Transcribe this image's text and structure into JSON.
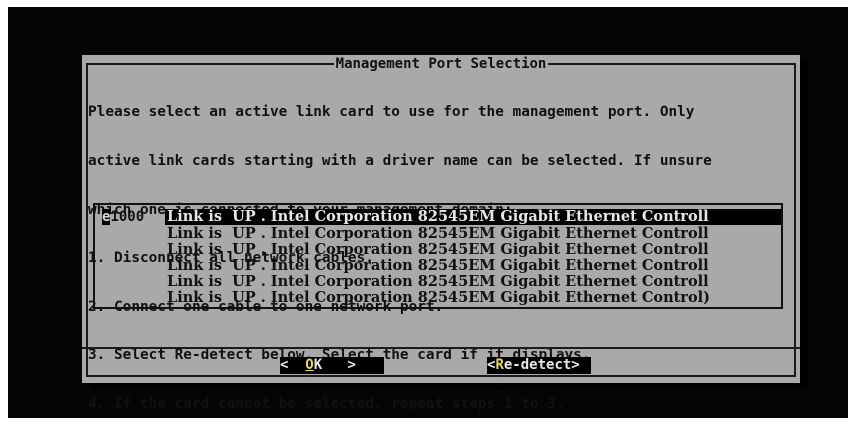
{
  "dialog": {
    "title": "Management Port Selection",
    "instructions": [
      "Please select an active link card to use for the management port. Only",
      "active link cards starting with a driver name can be selected. If unsure",
      "which one is connected to your management domain:",
      "1. Disconnect all network cables.",
      "2. Connect one cable to one network port.",
      "3. Select Re-detect below. Select the card if it displays.",
      "4. If the card cannot be selected, repeat steps 1 to 3."
    ],
    "cards": [
      {
        "driver_first": "e",
        "driver_rest": "1000",
        "desc": "Link is  UP . Intel Corporation 82545EM Gigabit Ethernet Controll"
      },
      {
        "driver_first": "",
        "driver_rest": "",
        "desc": "Link is  UP . Intel Corporation 82545EM Gigabit Ethernet Controll"
      },
      {
        "driver_first": "",
        "driver_rest": "",
        "desc": "Link is  UP . Intel Corporation 82545EM Gigabit Ethernet Controll"
      },
      {
        "driver_first": "",
        "driver_rest": "",
        "desc": "Link is  UP . Intel Corporation 82545EM Gigabit Ethernet Controll"
      },
      {
        "driver_first": "",
        "driver_rest": "",
        "desc": "Link is  UP . Intel Corporation 82545EM Gigabit Ethernet Controll"
      },
      {
        "driver_first": "",
        "driver_rest": "",
        "desc": "Link is  UP . Intel Corporation 82545EM Gigabit Ethernet Control)"
      }
    ],
    "ok_button": {
      "left": "<  ",
      "hot": "O",
      "rest": "K   >"
    },
    "redetect_button": {
      "left": "<",
      "hot": "R",
      "rest": "e-detect>"
    }
  },
  "colors": {
    "screen_bg": "#050505",
    "dialog_bg": "#a9a9a9",
    "selected_bg": "#000000",
    "hotkey": "#e8d84a"
  }
}
